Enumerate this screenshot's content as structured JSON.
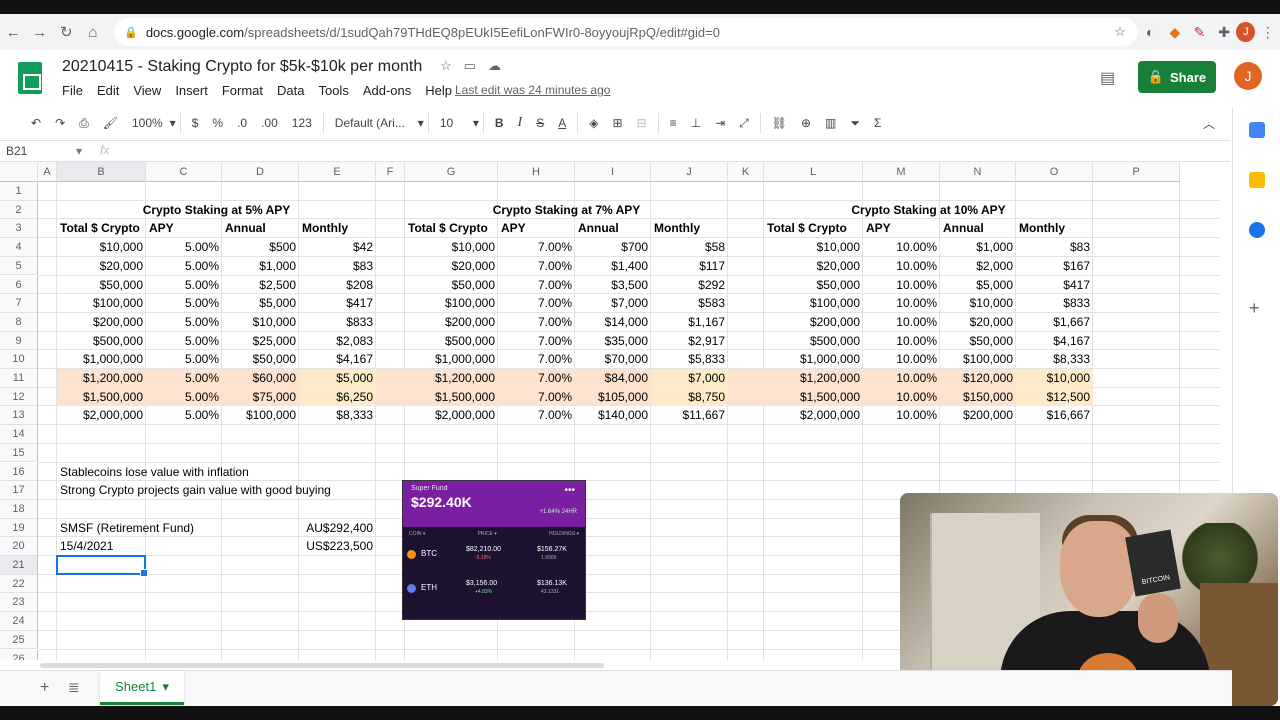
{
  "browser": {
    "url_host": "docs.google.com",
    "url_path": "/spreadsheets/d/1sudQah79THdEQ8pEUkI5EefiLonFWIr0-8oyyoujRpQ/edit#gid=0",
    "profile_initial": "J"
  },
  "doc": {
    "title": "20210415 - Staking Crypto for $5k-$10k per month",
    "menu": [
      "File",
      "Edit",
      "View",
      "Insert",
      "Format",
      "Data",
      "Tools",
      "Add-ons",
      "Help"
    ],
    "last_edit": "Last edit was 24 minutes ago",
    "share_label": "Share",
    "user_initial": "J"
  },
  "toolbar": {
    "zoom": "100%",
    "currency": "$",
    "percent": "%",
    "dec_less": ".0",
    "dec_more": ".00",
    "format": "123",
    "font": "Default (Ari...",
    "font_size": "10",
    "bold": "B",
    "italic": "I",
    "strike": "S",
    "textcolor": "A",
    "sum": "Σ"
  },
  "formula_bar": {
    "name_box": "B21",
    "fx": "fx"
  },
  "columns": [
    "A",
    "B",
    "C",
    "D",
    "E",
    "F",
    "G",
    "H",
    "I",
    "J",
    "K",
    "L",
    "M",
    "N",
    "O",
    "P"
  ],
  "rows": [
    "1",
    "2",
    "3",
    "4",
    "5",
    "6",
    "7",
    "8",
    "9",
    "10",
    "11",
    "12",
    "13",
    "14",
    "15",
    "16",
    "17",
    "18",
    "19",
    "20",
    "21",
    "22",
    "23",
    "24",
    "25",
    "26"
  ],
  "tables": [
    {
      "title": "Crypto Staking at 5% APY",
      "headers": [
        "Total $ Crypto",
        "APY",
        "Annual",
        "Monthly"
      ],
      "rows": [
        [
          "$10,000",
          "5.00%",
          "$500",
          "$42"
        ],
        [
          "$20,000",
          "5.00%",
          "$1,000",
          "$83"
        ],
        [
          "$50,000",
          "5.00%",
          "$2,500",
          "$208"
        ],
        [
          "$100,000",
          "5.00%",
          "$5,000",
          "$417"
        ],
        [
          "$200,000",
          "5.00%",
          "$10,000",
          "$833"
        ],
        [
          "$500,000",
          "5.00%",
          "$25,000",
          "$2,083"
        ],
        [
          "$1,000,000",
          "5.00%",
          "$50,000",
          "$4,167"
        ],
        [
          "$1,200,000",
          "5.00%",
          "$60,000",
          "$5,000"
        ],
        [
          "$1,500,000",
          "5.00%",
          "$75,000",
          "$6,250"
        ],
        [
          "$2,000,000",
          "5.00%",
          "$100,000",
          "$8,333"
        ]
      ]
    },
    {
      "title": "Crypto Staking at 7% APY",
      "headers": [
        "Total $ Crypto",
        "APY",
        "Annual",
        "Monthly"
      ],
      "rows": [
        [
          "$10,000",
          "7.00%",
          "$700",
          "$58"
        ],
        [
          "$20,000",
          "7.00%",
          "$1,400",
          "$117"
        ],
        [
          "$50,000",
          "7.00%",
          "$3,500",
          "$292"
        ],
        [
          "$100,000",
          "7.00%",
          "$7,000",
          "$583"
        ],
        [
          "$200,000",
          "7.00%",
          "$14,000",
          "$1,167"
        ],
        [
          "$500,000",
          "7.00%",
          "$35,000",
          "$2,917"
        ],
        [
          "$1,000,000",
          "7.00%",
          "$70,000",
          "$5,833"
        ],
        [
          "$1,200,000",
          "7.00%",
          "$84,000",
          "$7,000"
        ],
        [
          "$1,500,000",
          "7.00%",
          "$105,000",
          "$8,750"
        ],
        [
          "$2,000,000",
          "7.00%",
          "$140,000",
          "$11,667"
        ]
      ]
    },
    {
      "title": "Crypto Staking at 10% APY",
      "headers": [
        "Total $ Crypto",
        "APY",
        "Annual",
        "Monthly"
      ],
      "rows": [
        [
          "$10,000",
          "10.00%",
          "$1,000",
          "$83"
        ],
        [
          "$20,000",
          "10.00%",
          "$2,000",
          "$167"
        ],
        [
          "$50,000",
          "10.00%",
          "$5,000",
          "$417"
        ],
        [
          "$100,000",
          "10.00%",
          "$10,000",
          "$833"
        ],
        [
          "$200,000",
          "10.00%",
          "$20,000",
          "$1,667"
        ],
        [
          "$500,000",
          "10.00%",
          "$50,000",
          "$4,167"
        ],
        [
          "$1,000,000",
          "10.00%",
          "$100,000",
          "$8,333"
        ],
        [
          "$1,200,000",
          "10.00%",
          "$120,000",
          "$10,000"
        ],
        [
          "$1,500,000",
          "10.00%",
          "$150,000",
          "$12,500"
        ],
        [
          "$2,000,000",
          "10.00%",
          "$200,000",
          "$16,667"
        ]
      ]
    }
  ],
  "notes": {
    "b16": "Stablecoins lose value with inflation",
    "b17": "Strong Crypto projects gain value with good buying",
    "b19": "SMSF (Retirement Fund)",
    "e19": "AU$292,400",
    "b20": "15/4/2021",
    "e20": "US$223,500"
  },
  "fund_widget": {
    "label": "Super Fund",
    "value": "$292.40K",
    "change": "+1.64%  24HR",
    "menu": "•••",
    "col_coin": "COIN ▾",
    "col_price": "PRICE ▾",
    "col_holdings": "HOLDINGS ▾",
    "assets": [
      {
        "symbol": "BTC",
        "price": "$82,210.00",
        "price_change": "-5.19%",
        "holdings": "$156.27K",
        "qty": "1.9009",
        "color": "#f7931a",
        "change_color": "#ff6b6b"
      },
      {
        "symbol": "ETH",
        "price": "$3,156.00",
        "price_change": "+4.83%",
        "holdings": "$136.13K",
        "qty": "43.1331",
        "color": "#627eea",
        "change_color": "#6be08b"
      }
    ]
  },
  "webcam": {
    "card_text": "BITCOIN"
  },
  "sheet_tab": {
    "label": "Sheet1"
  },
  "colors": {
    "green": "#188038",
    "highlight_row": "#fde3cf",
    "highlight_monthly": "#fdeac8",
    "selection": "#1a73e8"
  }
}
